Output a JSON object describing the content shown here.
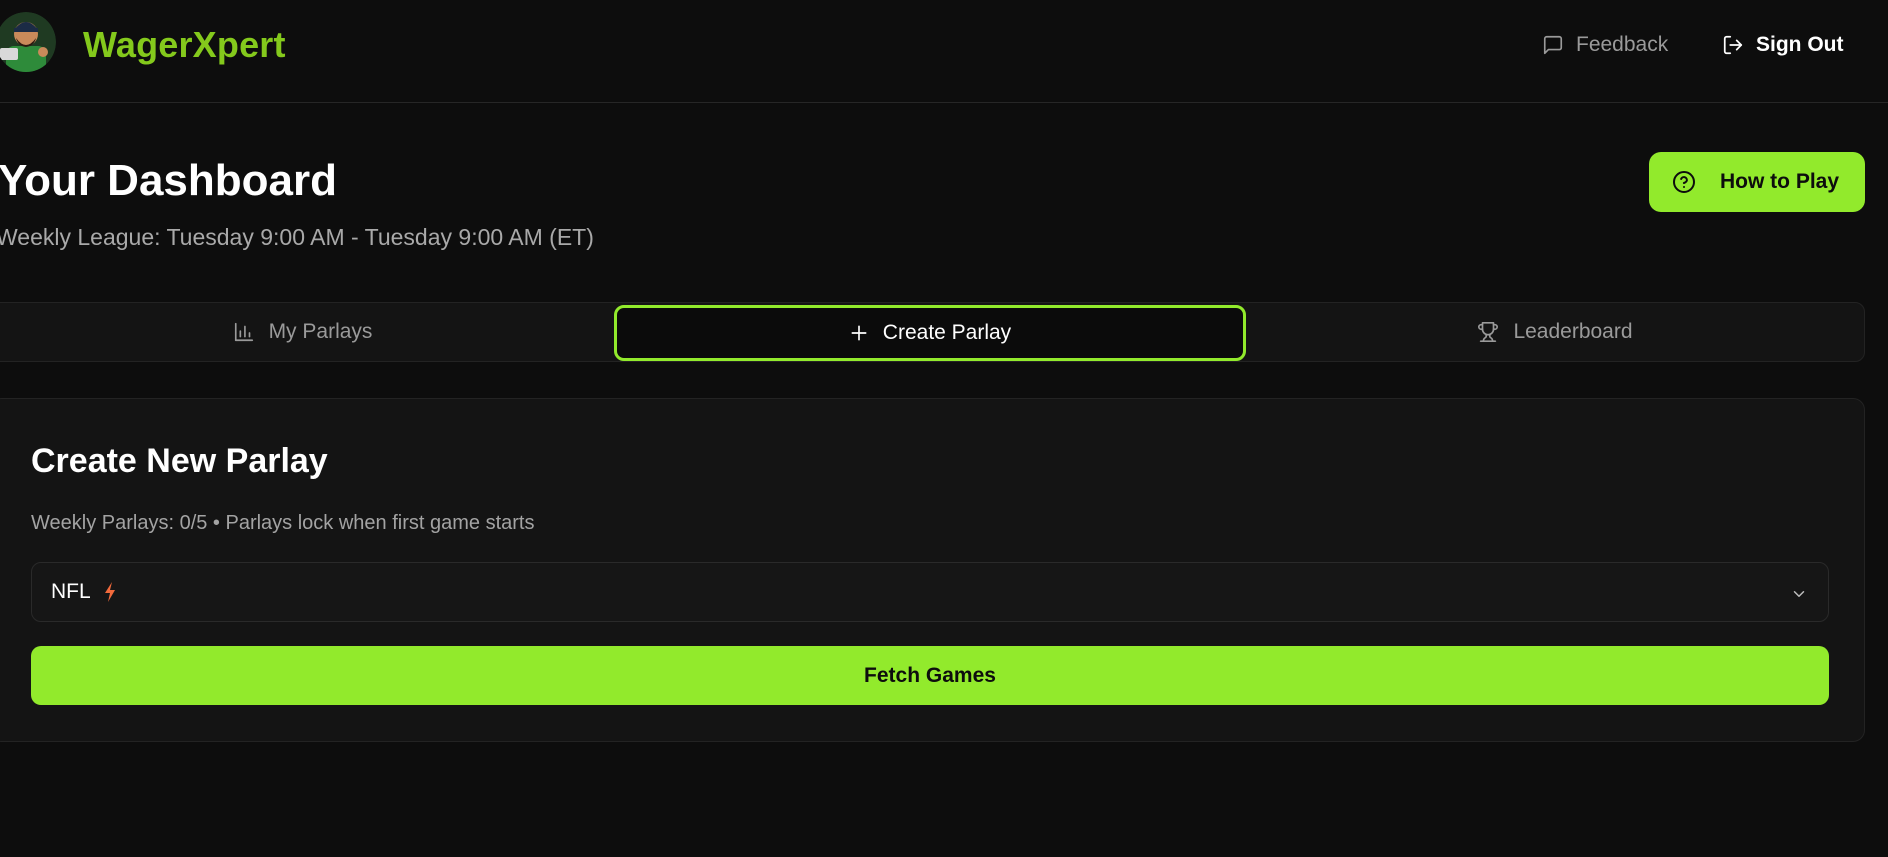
{
  "header": {
    "brand": "WagerXpert",
    "feedback_label": "Feedback",
    "signout_label": "Sign Out",
    "brand_color": "#84c91c"
  },
  "dashboard": {
    "title": "Your Dashboard",
    "subtitle": "Weekly League: Tuesday 9:00 AM - Tuesday 9:00 AM (ET)",
    "how_to_play_label": "How to Play"
  },
  "tabs": [
    {
      "label": "My Parlays",
      "icon": "bar-chart-icon",
      "active": false
    },
    {
      "label": "Create Parlay",
      "icon": "plus-icon",
      "active": true
    },
    {
      "label": "Leaderboard",
      "icon": "trophy-icon",
      "active": false
    }
  ],
  "create_parlay": {
    "title": "Create New Parlay",
    "subtitle": "Weekly Parlays: 0/5 • Parlays lock when first game starts",
    "sport_select_value": "NFL",
    "sport_icon": "lightning-bolt-icon",
    "fetch_button_label": "Fetch Games"
  },
  "colors": {
    "accent": "#92ea2c",
    "background": "#0d0d0d",
    "card": "#141414",
    "muted_text": "#a3a3a3"
  }
}
